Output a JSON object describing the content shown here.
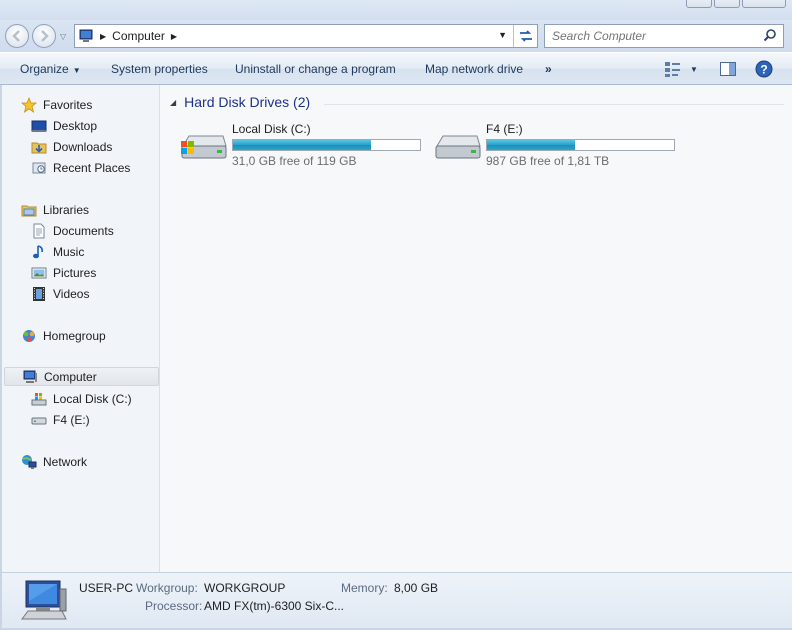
{
  "window": {
    "title": "Computer"
  },
  "address_bar": {
    "crumb": "Computer",
    "search_placeholder": "Search Computer"
  },
  "toolbar": {
    "organize": "Organize",
    "system_properties": "System properties",
    "uninstall": "Uninstall or change a program",
    "map_network": "Map network drive",
    "more": "»"
  },
  "nav": {
    "favorites": "Favorites",
    "desktop": "Desktop",
    "downloads": "Downloads",
    "recent_places": "Recent Places",
    "libraries": "Libraries",
    "documents": "Documents",
    "music": "Music",
    "pictures": "Pictures",
    "videos": "Videos",
    "homegroup": "Homegroup",
    "computer": "Computer",
    "local_disk": "Local Disk (C:)",
    "f4": "F4 (E:)",
    "network": "Network"
  },
  "content": {
    "group_title": "Hard Disk Drives (2)",
    "drives": [
      {
        "name": "Local Disk (C:)",
        "free_text": "31,0 GB free of 119 GB",
        "used_fraction": 0.74
      },
      {
        "name": "F4 (E:)",
        "free_text": "987 GB free of 1,81 TB",
        "used_fraction": 0.47
      }
    ]
  },
  "details": {
    "computer_name": "USER-PC",
    "workgroup_label": "Workgroup:",
    "workgroup_value": "WORKGROUP",
    "memory_label": "Memory:",
    "memory_value": "8,00 GB",
    "processor_label": "Processor:",
    "processor_value": "AMD FX(tm)-6300 Six-C..."
  },
  "colors": {
    "accent": "#1e3287",
    "bar_fill": "#26a0c9",
    "toolbar_text": "#1e395b"
  }
}
